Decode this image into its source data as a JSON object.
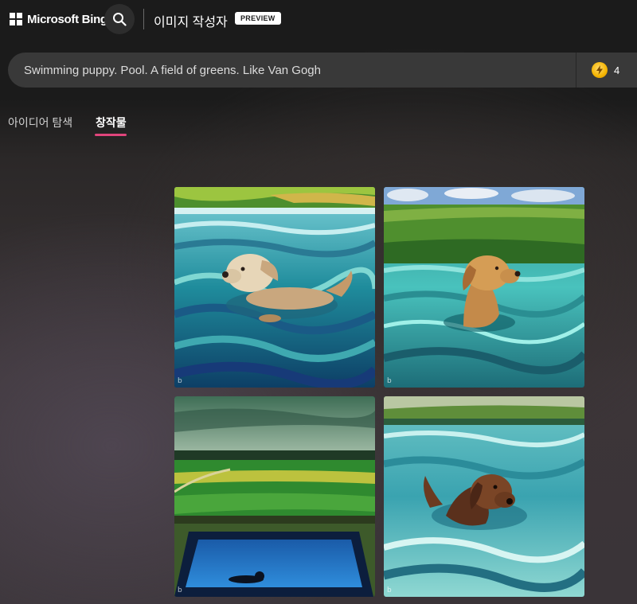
{
  "header": {
    "brand": "Microsoft Bing",
    "app_title": "이미지 작성자",
    "badge": "PREVIEW",
    "search_icon": "search-icon"
  },
  "search": {
    "prompt": "Swimming puppy. Pool. A field of greens. Like Van Gogh",
    "boost_count": "4",
    "boost_icon": "lightning-coin-icon"
  },
  "tabs": [
    {
      "label": "아이디어 탐색",
      "active": false
    },
    {
      "label": "창작물",
      "active": true
    }
  ],
  "tab_accent_color": "#e0457b",
  "gallery": {
    "images": [
      {
        "subject": "puppy swimming in swirling teal water with green field horizon",
        "watermark": "b"
      },
      {
        "subject": "golden puppy in turquoise water with green field and cloudy sky",
        "watermark": "b"
      },
      {
        "subject": "green fields landscape above a dark blue pool",
        "watermark": "b"
      },
      {
        "subject": "brown puppy swimming in light teal waves",
        "watermark": "b"
      }
    ]
  }
}
